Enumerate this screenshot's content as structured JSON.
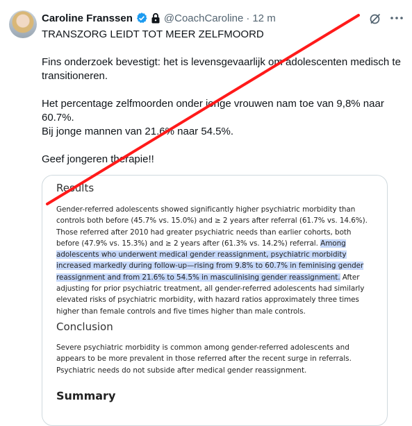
{
  "author": {
    "name": "Caroline Franssen",
    "handle": "@CoachCaroline",
    "separator": "·",
    "time": "12 m"
  },
  "icons": {
    "verified": "verified-badge-icon",
    "lock": "lock-icon",
    "grok": "grok-icon",
    "more": "more-options-icon"
  },
  "tweet": {
    "line1": "TRANSZORG LEIDT TOT MEER ZELFMOORD",
    "para2": "Fins onderzoek bevestigt: het is levensgevaarlijk om adolescenten medisch te transitioneren.",
    "para3": "Het percentage zelfmoorden onder jonge vrouwen nam toe van 9,8% naar 60.7%.\nBij jonge mannen van 21.6% naar 54.5%.",
    "para4": "Geef jongeren therapie!!"
  },
  "image": {
    "results_heading": "Results",
    "results_text_a": "Gender-referred adolescents showed significantly higher psychiatric morbidity than controls both before (45.7% vs. 15.0%) and ≥ 2 years after referral (61.7% vs. 14.6%). Those referred after 2010 had greater psychiatric needs than earlier cohorts, both before (47.9% vs. 15.3%) and ≥ 2 years after (61.3% vs. 14.2%) referral. ",
    "results_text_highlight": "Among adolescents who underwent medical gender reassignment, psychiatric morbidity increased markedly during follow-up—rising from 9.8% to 60.7% in feminising gender reassignment and from 21.6% to 54.5% in masculinising gender reassignment.",
    "results_text_b": " After adjusting for prior psychiatric treatment, all gender-referred adolescents had similarly elevated risks of psychiatric morbidity, with hazard ratios approximately three times higher than female controls and five times higher than male controls.",
    "conclusion_heading": "Conclusion",
    "conclusion_text": "Severe psychiatric morbidity is common among gender-referred adolescents and appears to be more prevalent in those referred after the recent surge in referrals. Psychiatric needs do not subside after medical gender reassignment.",
    "summary_heading": "Summary"
  },
  "colors": {
    "slash": "#ff1a1a",
    "verified": "#1d9bf0",
    "highlight": "#c7d9fb"
  }
}
